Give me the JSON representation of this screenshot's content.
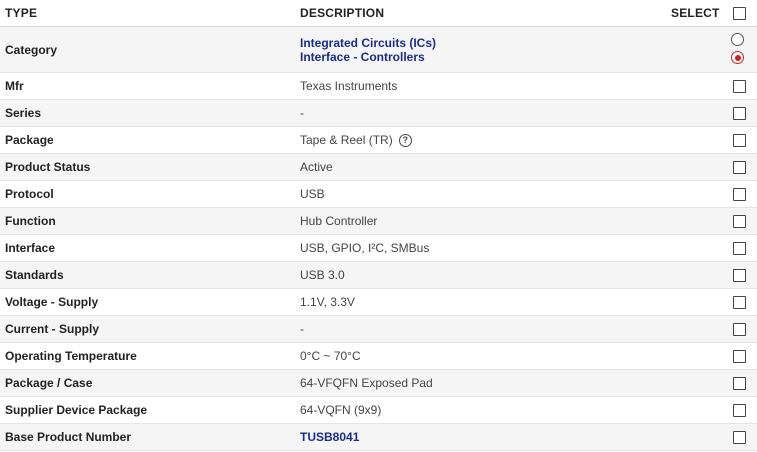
{
  "header": {
    "type": "TYPE",
    "description": "DESCRIPTION",
    "select": "SELECT"
  },
  "category": {
    "label": "Category",
    "line1": "Integrated Circuits (ICs)",
    "line2": "Interface - Controllers"
  },
  "rows": [
    {
      "type": "Mfr",
      "desc": "Texas Instruments"
    },
    {
      "type": "Series",
      "desc": "-"
    },
    {
      "type": "Package",
      "desc": "Tape & Reel (TR)",
      "help_icon": "question-circle-icon"
    },
    {
      "type": "Product Status",
      "desc": "Active"
    },
    {
      "type": "Protocol",
      "desc": "USB"
    },
    {
      "type": "Function",
      "desc": "Hub Controller"
    },
    {
      "type": "Interface",
      "desc": "USB, GPIO, I²C, SMBus"
    },
    {
      "type": "Standards",
      "desc": "USB 3.0"
    },
    {
      "type": "Voltage - Supply",
      "desc": "1.1V, 3.3V"
    },
    {
      "type": "Current - Supply",
      "desc": "-"
    },
    {
      "type": "Operating Temperature",
      "desc": "0°C ~ 70°C"
    },
    {
      "type": "Package / Case",
      "desc": "64-VFQFN Exposed Pad"
    },
    {
      "type": "Supplier Device Package",
      "desc": "64-VQFN (9x9)"
    },
    {
      "type": "Base Product Number",
      "desc": "TUSB8041",
      "is_link": true
    }
  ],
  "colors": {
    "link": "#1a2d8c",
    "radio_selected": "#cc1f1f",
    "alt_row": "#f5f5f5"
  }
}
